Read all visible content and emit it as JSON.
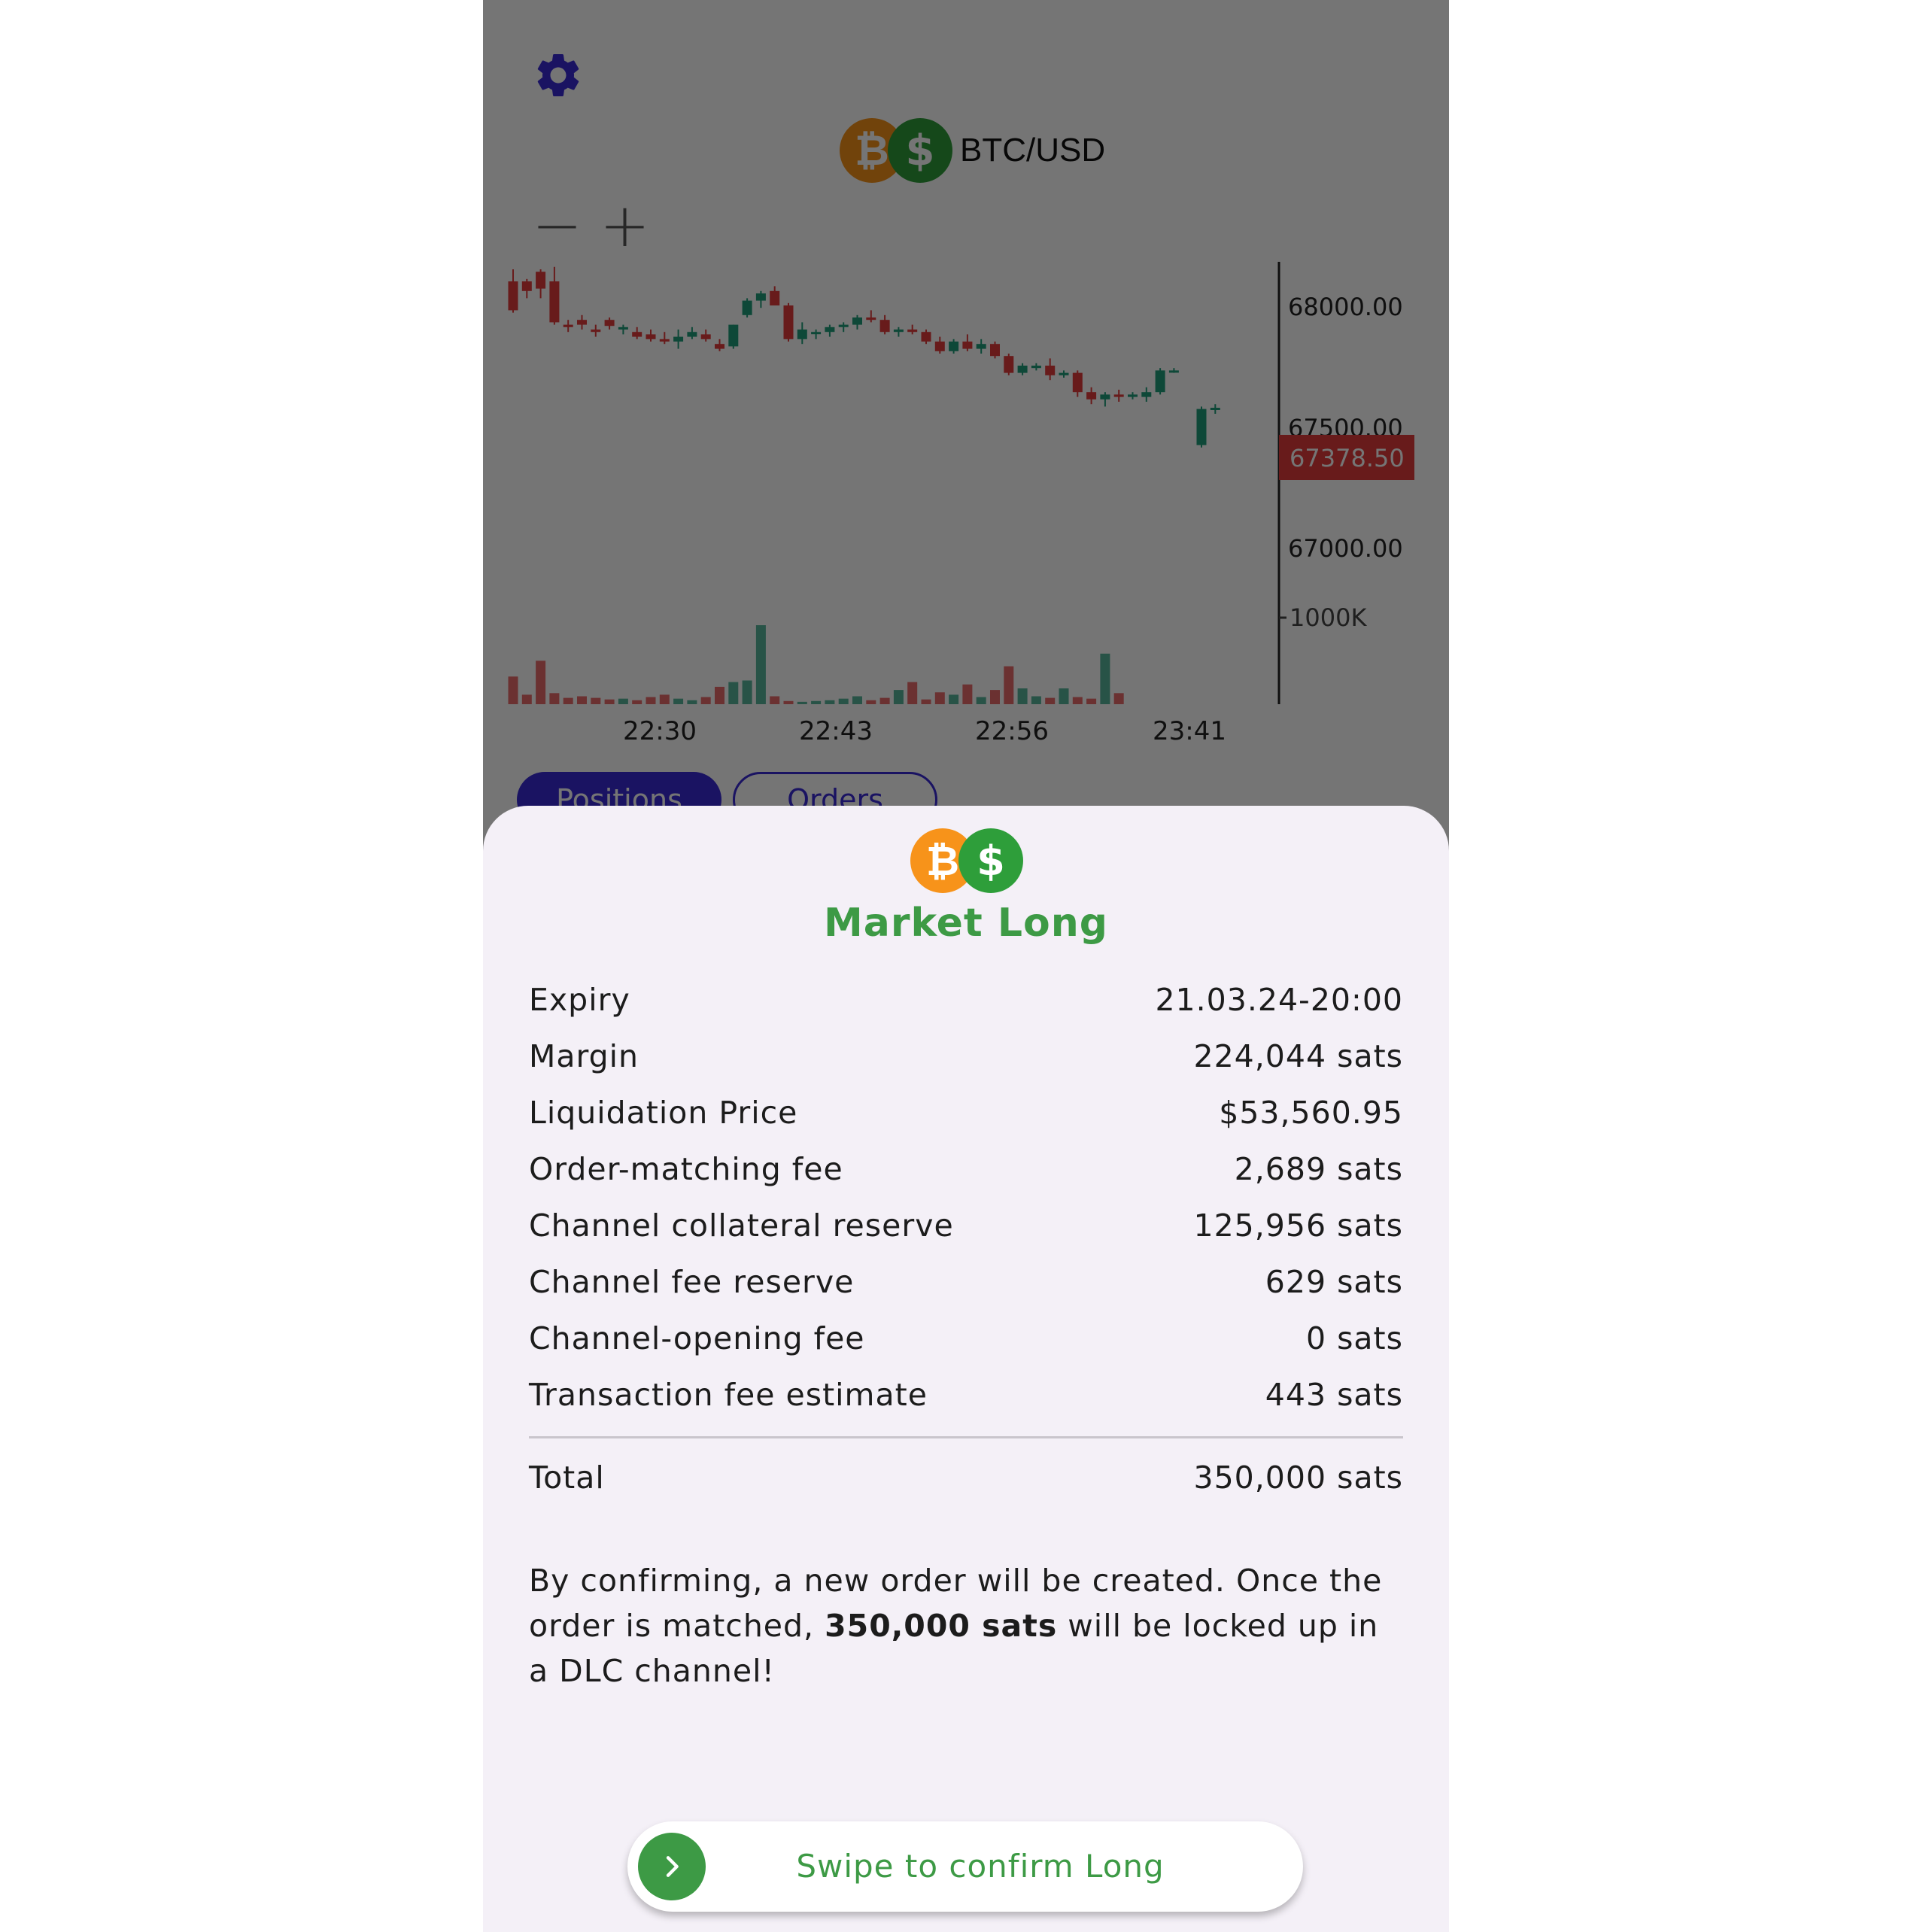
{
  "header": {
    "pair_label": "BTC/USD",
    "btc_symbol": "₿",
    "usd_symbol": "$",
    "icons": [
      "gear-icon",
      "minus-icon",
      "plus-icon"
    ],
    "zoom_out": "−",
    "zoom_in": "+"
  },
  "chart_data": {
    "type": "candlestick",
    "y_ticks": [
      "68000.00",
      "67500.00",
      "67000.00"
    ],
    "current_price": "67378.50",
    "volume_tick": "1000K",
    "x_ticks": [
      "22:30",
      "22:43",
      "22:56",
      "23:41"
    ],
    "y_range": [
      66500,
      68250
    ],
    "candles": [
      [
        67900,
        67950,
        67770,
        67780
      ],
      [
        67900,
        67910,
        67830,
        67860
      ],
      [
        67940,
        67950,
        67830,
        67870
      ],
      [
        67900,
        67960,
        67720,
        67730
      ],
      [
        67720,
        67740,
        67690,
        67710
      ],
      [
        67740,
        67760,
        67700,
        67720
      ],
      [
        67700,
        67720,
        67670,
        67690
      ],
      [
        67740,
        67750,
        67700,
        67715
      ],
      [
        67700,
        67720,
        67680,
        67710
      ],
      [
        67690,
        67710,
        67660,
        67670
      ],
      [
        67680,
        67700,
        67650,
        67660
      ],
      [
        67660,
        67690,
        67640,
        67650
      ],
      [
        67650,
        67700,
        67620,
        67670
      ],
      [
        67670,
        67710,
        67660,
        67690
      ],
      [
        67680,
        67700,
        67650,
        67660
      ],
      [
        67640,
        67660,
        67610,
        67620
      ],
      [
        67630,
        67720,
        67620,
        67720
      ],
      [
        67760,
        67830,
        67750,
        67820
      ],
      [
        67820,
        67860,
        67790,
        67850
      ],
      [
        67860,
        67880,
        67800,
        67800
      ],
      [
        67800,
        67810,
        67650,
        67660
      ],
      [
        67660,
        67730,
        67640,
        67700
      ],
      [
        67690,
        67700,
        67660,
        67690
      ],
      [
        67690,
        67720,
        67670,
        67710
      ],
      [
        67710,
        67730,
        67690,
        67720
      ],
      [
        67720,
        67760,
        67700,
        67750
      ],
      [
        67750,
        67780,
        67730,
        67740
      ],
      [
        67740,
        67760,
        67680,
        67690
      ],
      [
        67690,
        67710,
        67670,
        67700
      ],
      [
        67700,
        67720,
        67680,
        67690
      ],
      [
        67690,
        67700,
        67640,
        67650
      ],
      [
        67650,
        67670,
        67600,
        67610
      ],
      [
        67610,
        67660,
        67600,
        67650
      ],
      [
        67650,
        67680,
        67610,
        67620
      ],
      [
        67620,
        67660,
        67600,
        67640
      ],
      [
        67640,
        67650,
        67580,
        67590
      ],
      [
        67590,
        67600,
        67510,
        67520
      ],
      [
        67520,
        67560,
        67510,
        67550
      ],
      [
        67540,
        67560,
        67530,
        67550
      ],
      [
        67550,
        67580,
        67490,
        67510
      ],
      [
        67510,
        67530,
        67500,
        67520
      ],
      [
        67520,
        67530,
        67420,
        67440
      ],
      [
        67440,
        67460,
        67390,
        67410
      ],
      [
        67410,
        67440,
        67380,
        67430
      ],
      [
        67430,
        67450,
        67400,
        67420
      ],
      [
        67420,
        67440,
        67410,
        67430
      ],
      [
        67420,
        67460,
        67400,
        67440
      ],
      [
        67440,
        67540,
        67430,
        67530
      ],
      [
        67530,
        67540,
        67520,
        67530
      ],
      null,
      [
        67220,
        67380,
        67210,
        67370
      ],
      [
        67370,
        67390,
        67350,
        67375
      ]
    ],
    "volumes": [
      35,
      12,
      55,
      14,
      8,
      10,
      8,
      6,
      7,
      5,
      9,
      12,
      7,
      5,
      9,
      22,
      28,
      30,
      100,
      10,
      4,
      3,
      4,
      5,
      7,
      10,
      5,
      8,
      18,
      28,
      6,
      15,
      12,
      25,
      9,
      18,
      48,
      20,
      10,
      8,
      20,
      9,
      7,
      64,
      14,
      0,
      0,
      0,
      0,
      0,
      0,
      0
    ],
    "volume_colors": "mixed"
  },
  "tabs": {
    "positions": "Positions",
    "orders": "Orders"
  },
  "sheet": {
    "title": "Market Long",
    "rows": [
      {
        "label": "Expiry",
        "value": "21.03.24-20:00"
      },
      {
        "label": "Margin",
        "value": "224,044 sats"
      },
      {
        "label": "Liquidation Price",
        "value": "$53,560.95"
      },
      {
        "label": "Order-matching fee",
        "value": "2,689 sats"
      },
      {
        "label": "Channel collateral reserve",
        "value": "125,956 sats"
      },
      {
        "label": "Channel fee reserve",
        "value": "629 sats"
      },
      {
        "label": "Channel-opening fee",
        "value": "0 sats"
      },
      {
        "label": "Transaction fee estimate",
        "value": "443 sats"
      }
    ],
    "total": {
      "label": "Total",
      "value": "350,000 sats"
    },
    "note_prefix": "By confirming, a new order will be created. Once the order is matched, ",
    "note_bold": "350,000 sats",
    "note_suffix": " will be locked up in a DLC channel!",
    "swipe_label": "Swipe to confirm Long"
  },
  "colors": {
    "accent": "#3a2bd6",
    "long_green": "#3d9a45",
    "candle_up": "#1f9e7a",
    "candle_down": "#e23b3b",
    "btc_orange": "#f7931a",
    "usd_green": "#2e9e3a",
    "sheet_bg": "#f4f0f7"
  }
}
